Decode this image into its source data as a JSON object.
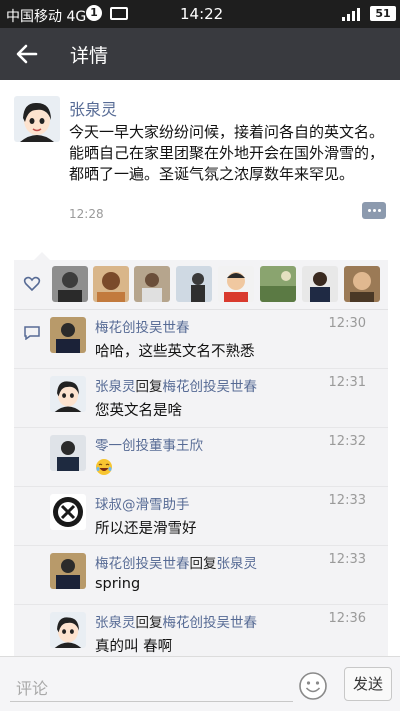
{
  "status": {
    "carrier": "中国移动 4G",
    "notification_count": "1",
    "time": "14:22",
    "signal": "4G",
    "battery": "51"
  },
  "header": {
    "title": "详情"
  },
  "post": {
    "author": "张泉灵",
    "content": "今天一早大家纷纷问候，接着问各自的英文名。能晒自己在家里团聚在外地开会在国外滑雪的，都晒了一遍。圣诞气氛之浓厚数年来罕见。",
    "time": "12:28"
  },
  "likes": [
    "liker-1",
    "liker-2",
    "liker-3",
    "liker-4",
    "liker-5",
    "liker-6",
    "liker-7",
    "liker-8"
  ],
  "comments": [
    {
      "author": "梅花创投吴世春",
      "reply_word": "",
      "reply_to": "",
      "time": "12:30",
      "text": "哈哈，这些英文名不熟悉"
    },
    {
      "author": "张泉灵",
      "reply_word": "回复",
      "reply_to": "梅花创投吴世春",
      "time": "12:31",
      "text": "您英文名是啥"
    },
    {
      "author": "零一创投董事王欣",
      "reply_word": "",
      "reply_to": "",
      "time": "12:32",
      "text": "",
      "emoji": "laughing-emoji-icon"
    },
    {
      "author": "球叔@滑雪助手",
      "reply_word": "",
      "reply_to": "",
      "time": "12:33",
      "text": "所以还是滑雪好"
    },
    {
      "author": "梅花创投吴世春",
      "reply_word": "回复",
      "reply_to": "张泉灵",
      "time": "12:33",
      "text": "spring"
    },
    {
      "author": "张泉灵",
      "reply_word": "回复",
      "reply_to": "梅花创投吴世春",
      "time": "12:36",
      "text": "真的叫 春啊"
    }
  ],
  "compose": {
    "placeholder": "评论",
    "send_label": "发送"
  },
  "colors": {
    "link": "#576b95",
    "header": "#393a3f",
    "panel": "#f3f3f5"
  }
}
